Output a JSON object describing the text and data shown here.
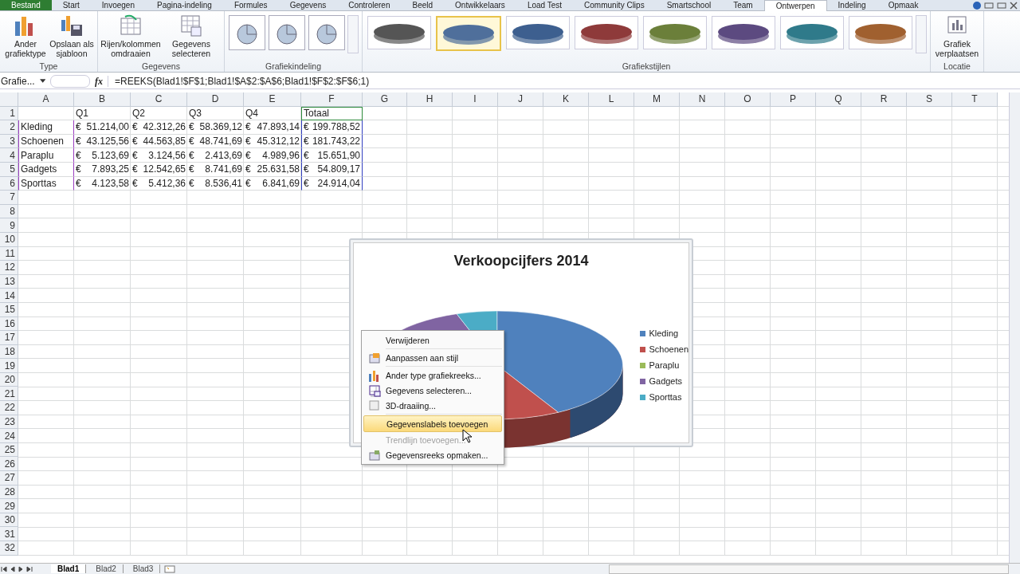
{
  "ribbon_tabs": [
    {
      "label": "Bestand",
      "selected": false,
      "kind": "file"
    },
    {
      "label": "Start",
      "selected": false,
      "kind": "tab"
    },
    {
      "label": "Invoegen",
      "selected": false,
      "kind": "tab"
    },
    {
      "label": "Pagina-indeling",
      "selected": false,
      "kind": "tab"
    },
    {
      "label": "Formules",
      "selected": false,
      "kind": "tab"
    },
    {
      "label": "Gegevens",
      "selected": false,
      "kind": "tab"
    },
    {
      "label": "Controleren",
      "selected": false,
      "kind": "tab"
    },
    {
      "label": "Beeld",
      "selected": false,
      "kind": "tab"
    },
    {
      "label": "Ontwikkelaars",
      "selected": false,
      "kind": "tab"
    },
    {
      "label": "Load Test",
      "selected": false,
      "kind": "tab"
    },
    {
      "label": "Community Clips",
      "selected": false,
      "kind": "tab"
    },
    {
      "label": "Smartschool",
      "selected": false,
      "kind": "tab"
    },
    {
      "label": "Team",
      "selected": false,
      "kind": "tab"
    },
    {
      "label": "Ontwerpen",
      "selected": true,
      "kind": "tab"
    },
    {
      "label": "Indeling",
      "selected": false,
      "kind": "tab"
    },
    {
      "label": "Opmaak",
      "selected": false,
      "kind": "tab"
    }
  ],
  "ribbon_groups": [
    {
      "label": "Type",
      "kind": "buttons",
      "buttons": [
        {
          "label": "Ander grafiektype"
        },
        {
          "label": "Opslaan als sjabloon"
        }
      ]
    },
    {
      "label": "Gegevens",
      "kind": "buttons",
      "buttons": [
        {
          "label": "Rijen/kolommen omdraaien"
        },
        {
          "label": "Gegevens selecteren"
        }
      ]
    },
    {
      "label": "Grafiekindeling",
      "kind": "layouts",
      "layouts": [
        {
          "selected": false
        },
        {
          "selected": false
        },
        {
          "selected": false
        }
      ]
    },
    {
      "label": "Grafiekstijlen",
      "kind": "styles",
      "styles": [
        {
          "color": "#555555",
          "selected": false
        },
        {
          "color": "#4f6f9b",
          "selected": true
        },
        {
          "color": "#3d5f8f",
          "selected": false
        },
        {
          "color": "#8e3a3a",
          "selected": false
        },
        {
          "color": "#6b7f3a",
          "selected": false
        },
        {
          "color": "#5c4a80",
          "selected": false
        },
        {
          "color": "#2f7a8a",
          "selected": false
        },
        {
          "color": "#a0602f",
          "selected": false
        }
      ]
    },
    {
      "label": "Locatie",
      "kind": "buttons",
      "buttons": [
        {
          "label": "Grafiek verplaatsen"
        }
      ]
    }
  ],
  "formula_bar": {
    "name_box": "Grafie...",
    "fx": "fx",
    "formula": "=REEKS(Blad1!$F$1;Blad1!$A$2:$A$6;Blad1!$F$2:$F$6;1)"
  },
  "columns": [
    "A",
    "B",
    "C",
    "D",
    "E",
    "F",
    "G",
    "H",
    "I",
    "J",
    "K",
    "L",
    "M",
    "N",
    "O",
    "P",
    "Q",
    "R",
    "S",
    "T"
  ],
  "row_numbers": [
    "1",
    "2",
    "3",
    "4",
    "5",
    "6",
    "7",
    "8",
    "9",
    "10",
    "11",
    "12",
    "13",
    "14",
    "15",
    "16",
    "17",
    "18",
    "19",
    "20",
    "21",
    "22",
    "23",
    "24",
    "25",
    "26",
    "27",
    "28",
    "29",
    "30",
    "31",
    "32"
  ],
  "rows": [
    {
      "label": "",
      "cells": [
        {
          "text": "Q1"
        },
        {
          "text": "Q2"
        },
        {
          "text": "Q3"
        },
        {
          "text": "Q4"
        },
        {
          "text": "Totaal"
        }
      ]
    },
    {
      "label": "Kleding",
      "cells": [
        {
          "symbol": "€",
          "amount": "51.214,00"
        },
        {
          "symbol": "€",
          "amount": "42.312,26"
        },
        {
          "symbol": "€",
          "amount": "58.369,12"
        },
        {
          "symbol": "€",
          "amount": "47.893,14"
        },
        {
          "symbol": "€",
          "amount": "199.788,52"
        }
      ]
    },
    {
      "label": "Schoenen",
      "cells": [
        {
          "symbol": "€",
          "amount": "43.125,56"
        },
        {
          "symbol": "€",
          "amount": "44.563,85"
        },
        {
          "symbol": "€",
          "amount": "48.741,69"
        },
        {
          "symbol": "€",
          "amount": "45.312,12"
        },
        {
          "symbol": "€",
          "amount": "181.743,22"
        }
      ]
    },
    {
      "label": "Paraplu",
      "cells": [
        {
          "symbol": "€",
          "amount": "5.123,69"
        },
        {
          "symbol": "€",
          "amount": "3.124,56"
        },
        {
          "symbol": "€",
          "amount": "2.413,69"
        },
        {
          "symbol": "€",
          "amount": "4.989,96"
        },
        {
          "symbol": "€",
          "amount": "15.651,90"
        }
      ]
    },
    {
      "label": "Gadgets",
      "cells": [
        {
          "symbol": "€",
          "amount": "7.893,25"
        },
        {
          "symbol": "€",
          "amount": "12.542,65"
        },
        {
          "symbol": "€",
          "amount": "8.741,69"
        },
        {
          "symbol": "€",
          "amount": "25.631,58"
        },
        {
          "symbol": "€",
          "amount": "54.809,17"
        }
      ]
    },
    {
      "label": "Sporttas",
      "cells": [
        {
          "symbol": "€",
          "amount": "4.123,58"
        },
        {
          "symbol": "€",
          "amount": "5.412,36"
        },
        {
          "symbol": "€",
          "amount": "8.536,41"
        },
        {
          "symbol": "€",
          "amount": "6.841,69"
        },
        {
          "symbol": "€",
          "amount": "24.914,04"
        }
      ]
    }
  ],
  "chart": {
    "title": "Verkoopcijfers 2014",
    "legend": [
      {
        "label": "Kleding",
        "color": "#4f81bd"
      },
      {
        "label": "Schoenen",
        "color": "#c0504d"
      },
      {
        "label": "Paraplu",
        "color": "#9bbb59"
      },
      {
        "label": "Gadgets",
        "color": "#8064a2"
      },
      {
        "label": "Sporttas",
        "color": "#4bacc6"
      }
    ]
  },
  "context_menu": [
    {
      "label": "Verwijderen",
      "disabled": false,
      "selected": false
    },
    {
      "label": "Aanpassen aan stijl",
      "disabled": false,
      "selected": false
    },
    {
      "label": "Ander type grafiekreeks...",
      "disabled": false,
      "selected": false
    },
    {
      "label": "Gegevens selecteren...",
      "disabled": false,
      "selected": false
    },
    {
      "label": "3D-draaiing...",
      "disabled": false,
      "selected": false
    },
    {
      "label": "Gegevenslabels toevoegen",
      "disabled": false,
      "selected": true
    },
    {
      "label": "Trendlijn toevoegen...",
      "disabled": true,
      "selected": false
    },
    {
      "label": "Gegevensreeks opmaken...",
      "disabled": false,
      "selected": false
    }
  ],
  "sheet_tabs": [
    {
      "label": "Blad1",
      "selected": true
    },
    {
      "label": "Blad2",
      "selected": false
    },
    {
      "label": "Blad3",
      "selected": false
    }
  ]
}
